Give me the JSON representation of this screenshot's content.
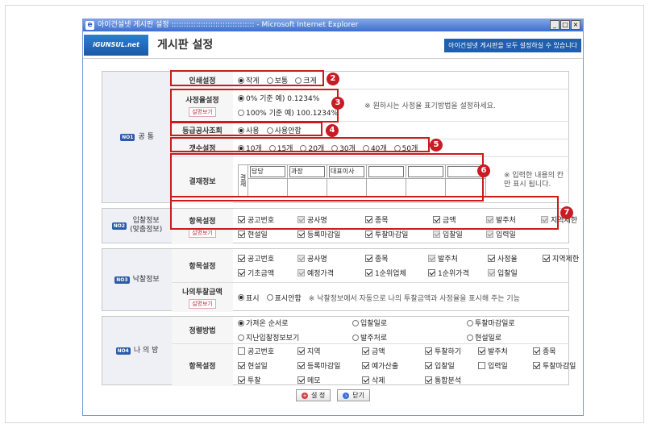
{
  "window": {
    "title": "아이건설넷 게시판 설정 :::::::::::::::::::::::::::::::::: - Microsoft Internet Explorer"
  },
  "header": {
    "logo_text": "iGUNSUL.net",
    "page_title": "게시판 설정",
    "banner": "아이건설넷 게시판을 모두 설정하실 수 있습니다"
  },
  "sections": {
    "general": {
      "badge": "NO1",
      "title": "공 통"
    },
    "bid": {
      "badge": "NO2",
      "title": "입찰정보",
      "subtitle": "(맞춤정보)"
    },
    "award": {
      "badge": "NO3",
      "title": "낙찰정보"
    },
    "my": {
      "badge": "NO4",
      "title": "나 의 방"
    }
  },
  "desc_label": "설명보기",
  "print": {
    "label": "인쇄설정",
    "options": [
      "작게",
      "보통",
      "크게"
    ]
  },
  "rate": {
    "label": "사정율설정",
    "opt1": "0% 기준   예) 0.1234%",
    "opt2": "100% 기준   예) 100.1234%",
    "note": "※ 원하시는 사정율 표기방법을 설정하세요."
  },
  "grade": {
    "label": "등급공사조회",
    "options": [
      "사용",
      "사용안함"
    ]
  },
  "count": {
    "label": "갯수설정",
    "options": [
      "10개",
      "15개",
      "20개",
      "30개",
      "40개",
      "50개"
    ]
  },
  "approval": {
    "label": "결재정보",
    "vertical": "결재",
    "cells": [
      "담당",
      "과장",
      "대표이사",
      "",
      "",
      ""
    ],
    "note": "※ 입력한 내용의 칸만 표시 됩니다."
  },
  "bid_items": {
    "label": "항목설정",
    "items": [
      "공고번호",
      "공사명",
      "종목",
      "금액",
      "발주처",
      "지역제한",
      "현설일",
      "등록마감일",
      "투찰마감일",
      "입찰일",
      "입력일"
    ]
  },
  "award_items": {
    "label": "항목설정",
    "items": [
      "공고번호",
      "공사명",
      "종목",
      "발주처",
      "사정율",
      "지역제한",
      "기초금액",
      "예정가격",
      "1순위업체",
      "1순위가격",
      "입찰일"
    ]
  },
  "my_bid": {
    "label": "나의투찰금액",
    "opt1": "표시",
    "opt2": "표시안함",
    "note": "※ 낙찰정보에서 자동으로 나의 투찰금액과 사정율을 표시해 주는 기능"
  },
  "sort": {
    "label": "정렬방법",
    "options": [
      "가져온 순서로",
      "입찰일로",
      "투찰마감일로",
      "지난입찰정보보기",
      "발주처로",
      "현설일로"
    ]
  },
  "my_items": {
    "label": "항목설정",
    "items": [
      "공고번호",
      "지역",
      "금액",
      "투찰하기",
      "발주처",
      "종목",
      "현설일",
      "등록마감일",
      "예가산출",
      "입찰일",
      "입력일",
      "투찰마감일",
      "투찰",
      "메모",
      "삭제",
      "통합분석"
    ]
  },
  "buttons": {
    "save": "설 정",
    "close": "닫기"
  },
  "markers": [
    "2",
    "3",
    "4",
    "5",
    "6",
    "7"
  ]
}
